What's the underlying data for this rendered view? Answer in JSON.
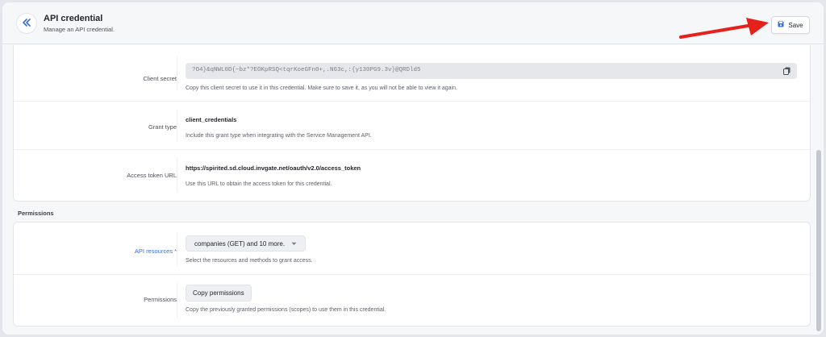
{
  "header": {
    "title": "API credential",
    "subtitle": "Manage an API credential.",
    "save_label": "Save",
    "back_icon": "double-chevron-left-icon",
    "save_icon": "floppy-disk-icon"
  },
  "colors": {
    "accent": "#3a6fd8",
    "arrow": "#e5211c"
  },
  "credential": {
    "client_secret": {
      "label": "Client secret",
      "value": "?O4}&qNWL0D{~bz*?EOKpRSQ<tqrKoeGFn0+,.N63c,:{y130PG9.3v}@QRDld5",
      "help": "Copy this client secret to use it in this credential. Make sure to save it, as you will not be able to view it again."
    },
    "grant_type": {
      "label": "Grant type",
      "value": "client_credentials",
      "help": "Include this grant type when integrating with the Service Management API."
    },
    "access_token_url": {
      "label": "Access token URL",
      "value": "https://spirited.sd.cloud.invgate.net/oauth/v2.0/access_token",
      "help": "Use this URL to obtain the access token for this credential."
    }
  },
  "permissions": {
    "section_title": "Permissions",
    "api_resources": {
      "label": "API resources *",
      "selected": "companies (GET) and 10 more.",
      "help": "Select the resources and methods to grant access."
    },
    "permissions_row": {
      "label": "Permissions",
      "button": "Copy permissions",
      "help": "Copy the previously granted permissions (scopes) to use them in this credential."
    }
  }
}
